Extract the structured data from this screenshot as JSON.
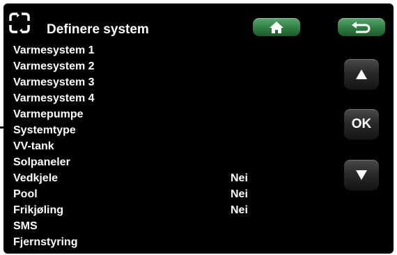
{
  "header": {
    "title": "Definere system",
    "mode_icon": "sync-frame-icon",
    "home_icon": "home-icon",
    "back_icon": "back-arrow-icon",
    "button_color": "#2f7d43"
  },
  "nav": {
    "up_icon": "up-triangle-icon",
    "ok_label": "OK",
    "down_icon": "down-triangle-icon"
  },
  "menu": {
    "items": [
      {
        "label": "Varmesystem 1",
        "value": ""
      },
      {
        "label": "Varmesystem 2",
        "value": ""
      },
      {
        "label": "Varmesystem 3",
        "value": ""
      },
      {
        "label": "Varmesystem 4",
        "value": ""
      },
      {
        "label": "Varmepumpe",
        "value": ""
      },
      {
        "label": "Systemtype",
        "value": ""
      },
      {
        "label": "VV-tank",
        "value": ""
      },
      {
        "label": "Solpaneler",
        "value": ""
      },
      {
        "label": "Vedkjele",
        "value": "Nei"
      },
      {
        "label": "Pool",
        "value": "Nei"
      },
      {
        "label": "Frikjøling",
        "value": "Nei"
      },
      {
        "label": "SMS",
        "value": ""
      },
      {
        "label": "Fjernstyring",
        "value": ""
      }
    ]
  }
}
